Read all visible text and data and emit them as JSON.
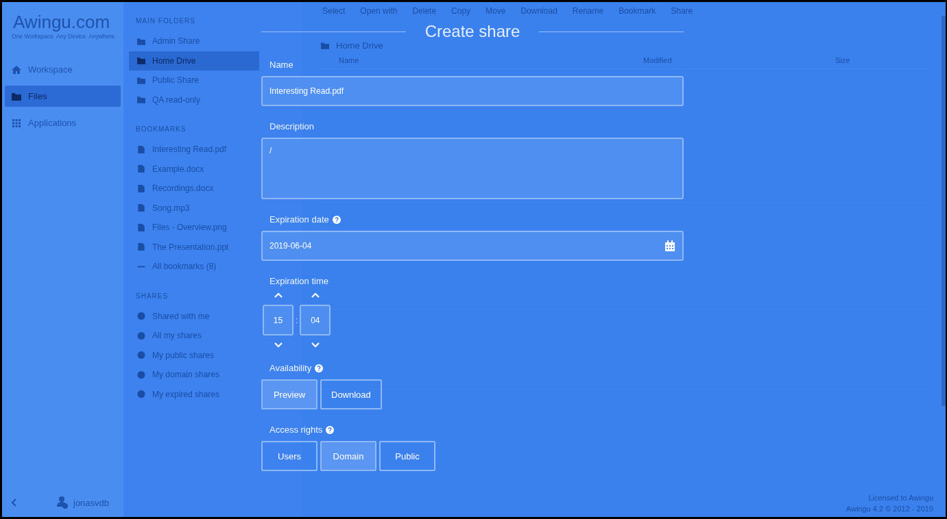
{
  "app": {
    "logo": "Awingu.com",
    "tagline": "One Workspace. Any Device. Anywhere."
  },
  "nav": [
    {
      "label": "Workspace",
      "selected": false,
      "kind": "home"
    },
    {
      "label": "Files",
      "selected": true,
      "kind": "folder"
    },
    {
      "label": "Applications",
      "selected": false,
      "kind": "grid"
    }
  ],
  "user": {
    "name": "jonasvdb"
  },
  "sections": [
    {
      "title": "MAIN FOLDERS",
      "items": [
        {
          "label": "Admin Share",
          "selected": false,
          "kind": "folder"
        },
        {
          "label": "Home Drive",
          "selected": true,
          "kind": "folder"
        },
        {
          "label": "Public Share",
          "selected": false,
          "kind": "folder"
        },
        {
          "label": "QA read-only",
          "selected": false,
          "kind": "folder"
        }
      ]
    },
    {
      "title": "BOOKMARKS",
      "items": [
        {
          "label": "Interesting Read.pdf",
          "selected": false,
          "kind": "file"
        },
        {
          "label": "Example.docx",
          "selected": false,
          "kind": "file"
        },
        {
          "label": "Recordings.docx",
          "selected": false,
          "kind": "file"
        },
        {
          "label": "Song.mp3",
          "selected": false,
          "kind": "file"
        },
        {
          "label": "Files - Overview.png",
          "selected": false,
          "kind": "file"
        },
        {
          "label": "The Presentation.ppt",
          "selected": false,
          "kind": "file"
        },
        {
          "label": "All bookmarks (8)",
          "selected": false,
          "kind": "more"
        }
      ]
    },
    {
      "title": "SHARES",
      "items": [
        {
          "label": "Shared with me",
          "selected": false,
          "kind": "share"
        },
        {
          "label": "All my shares",
          "selected": false,
          "kind": "share"
        },
        {
          "label": "My public shares",
          "selected": false,
          "kind": "share"
        },
        {
          "label": "My domain shares",
          "selected": false,
          "kind": "share"
        },
        {
          "label": "My expired shares",
          "selected": false,
          "kind": "share"
        }
      ]
    }
  ],
  "toolbar": [
    "Select",
    "Open with",
    "Delete",
    "Copy",
    "Move",
    "Download",
    "Rename",
    "Bookmark",
    "Share"
  ],
  "breadcrumb": "Home Drive",
  "columns": [
    "Name",
    "Modified",
    "Size"
  ],
  "footer": [
    "Licensed to Awingu",
    "Awingu 4.2 © 2012 - 2019"
  ],
  "dialog": {
    "title": "Create share",
    "fields": [
      {
        "kind": "text",
        "label": "Name",
        "help": false,
        "value": "Interesting Read.pdf"
      },
      {
        "kind": "textarea",
        "label": "Description",
        "help": false,
        "value": "/"
      },
      {
        "kind": "date",
        "label": "Expiration date",
        "help": true,
        "value": "2019-06-04"
      },
      {
        "kind": "time",
        "label": "Expiration time",
        "help": false,
        "hours": "15",
        "separator": ":",
        "minutes": "04"
      },
      {
        "kind": "choice",
        "label": "Availability",
        "help": true,
        "options": [
          {
            "label": "Preview",
            "selected": true
          },
          {
            "label": "Download",
            "selected": false
          }
        ]
      },
      {
        "kind": "choice",
        "label": "Access rights",
        "help": true,
        "options": [
          {
            "label": "Users",
            "selected": false
          },
          {
            "label": "Domain",
            "selected": true
          },
          {
            "label": "Public",
            "selected": false
          }
        ]
      }
    ]
  }
}
